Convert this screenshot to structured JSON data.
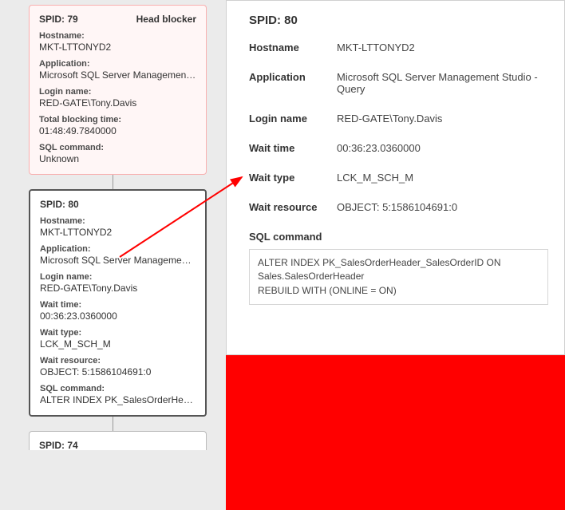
{
  "tree": {
    "card79": {
      "spid": "SPID: 79",
      "badge": "Head blocker",
      "hostname_k": "Hostname:",
      "hostname_v": "MKT-LTTONYD2",
      "app_k": "Application:",
      "app_v": "Microsoft SQL Server Management S...",
      "login_k": "Login name:",
      "login_v": "RED-GATE\\Tony.Davis",
      "block_k": "Total blocking time:",
      "block_v": "01:48:49.7840000",
      "sql_k": "SQL command:",
      "sql_v": "Unknown"
    },
    "card80": {
      "spid": "SPID: 80",
      "hostname_k": "Hostname:",
      "hostname_v": "MKT-LTTONYD2",
      "app_k": "Application:",
      "app_v": "Microsoft SQL Server Management S...",
      "login_k": "Login name:",
      "login_v": "RED-GATE\\Tony.Davis",
      "waittime_k": "Wait time:",
      "waittime_v": "00:36:23.0360000",
      "waittype_k": "Wait type:",
      "waittype_v": "LCK_M_SCH_M",
      "waitres_k": "Wait resource:",
      "waitres_v": "OBJECT: 5:1586104691:0",
      "sql_k": "SQL command:",
      "sql_v": "ALTER INDEX PK_SalesOrderHeader_..."
    },
    "card74": {
      "spid": "SPID: 74"
    }
  },
  "detail": {
    "title": "SPID: 80",
    "hostname_k": "Hostname",
    "hostname_v": "MKT-LTTONYD2",
    "app_k": "Application",
    "app_v": "Microsoft SQL Server Management Studio - Query",
    "login_k": "Login name",
    "login_v": "RED-GATE\\Tony.Davis",
    "waittime_k": "Wait time",
    "waittime_v": "00:36:23.0360000",
    "waittype_k": "Wait type",
    "waittype_v": "LCK_M_SCH_M",
    "waitres_k": "Wait resource",
    "waitres_v": "OBJECT: 5:1586104691:0",
    "sql_k": "SQL command",
    "sql_v": "ALTER INDEX PK_SalesOrderHeader_SalesOrderID ON Sales.SalesOrderHeader\nREBUILD WITH (ONLINE = ON)"
  }
}
